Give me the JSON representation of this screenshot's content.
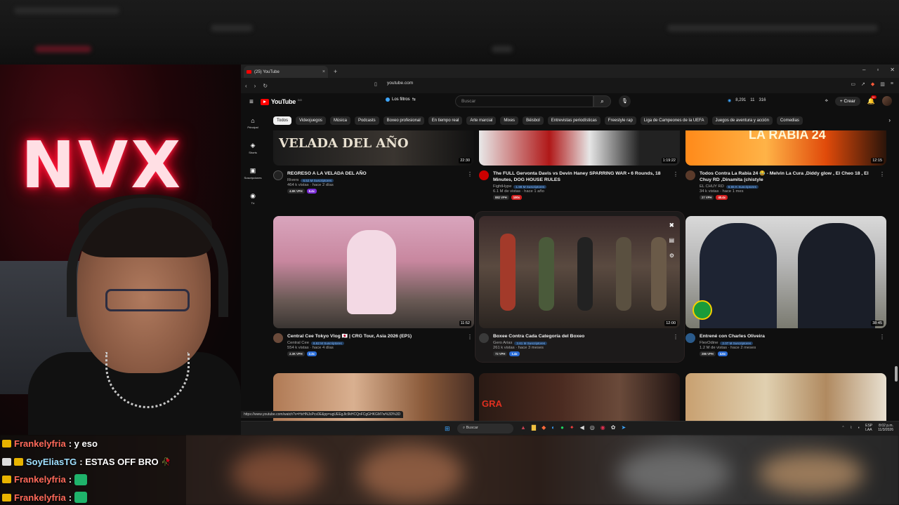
{
  "stream": {
    "neon_sign": "NVX"
  },
  "browser": {
    "tab_title": "(25) YouTube",
    "tab_close": "×",
    "tab_new": "+",
    "url": "youtube.com",
    "status_url": "https://www.youtube.com/watch?v=HxHNJsPcs0E&pp=ugUEEgJlc9kHCQnFCgGHKGM7w%3D%3D"
  },
  "youtube": {
    "logo_text": "YouTube",
    "logo_country": "DO",
    "filters_label": "Los filtros",
    "search_placeholder": "Buscar",
    "stats": {
      "a": "8,291",
      "b": "11",
      "c": "316"
    },
    "create_label": "Crear",
    "notif_badge": "9+",
    "sidebar": [
      {
        "icon": "⌂",
        "label": "Principal"
      },
      {
        "icon": "◈",
        "label": "Shorts"
      },
      {
        "icon": "▣",
        "label": "Suscripciones"
      },
      {
        "icon": "◉",
        "label": "Tú"
      }
    ],
    "chips": [
      "Todos",
      "Videojuegos",
      "Música",
      "Podcasts",
      "Boxeo profesional",
      "En tiempo real",
      "Arte marcial",
      "Mixes",
      "Béisbol",
      "Entrevistas periodísticas",
      "Freestyle rap",
      "Liga de Campeones de la UEFA",
      "Juegos de aventura y acción",
      "Comedias"
    ],
    "row1": [
      {
        "title": "REGRESO A LA VELADA DEL AÑO",
        "channel": "Rivers",
        "subs": "6.52 M Suscriptores",
        "views": "464 k vistas · hace 2 días",
        "vph": "4.8K VPH",
        "mult": "6.4x",
        "duration": "22:30",
        "thumb_text": "VELADA DEL AÑO"
      },
      {
        "title": "The FULL Gervonta Davis vs Devin Haney SPARRING WAR • 6 Rounds, 18 Minutes, DOG HOUSE RULES",
        "channel": "FightHype",
        "subs": "1.98 M Suscriptores",
        "views": "6.1 M de vistas · hace 1 año",
        "vph": "882 VPH",
        "mult": "100x",
        "duration": "1:19:22",
        "thumb_text": ""
      },
      {
        "title": "Todos Contra La Rabia 24 😂 - Melvin La Cura ,Diddy glow , El Cheo 18 , El Chuy RD ,Dinamita (chistyle",
        "channel": "EL CHUY RD",
        "subs": "6.65 K Suscriptores",
        "views": "34 k vistas · hace 1 mes",
        "vph": "27 VPH",
        "mult": "40.4x",
        "duration": "12:15",
        "thumb_text": "LA RABIA 24"
      }
    ],
    "row2": [
      {
        "title": "Central Cee Tokyo Vlog 🇯🇵 | CRG Tour, Asia 2026 (EP1)",
        "channel": "Central Cee",
        "subs": "6.62 M Suscriptores",
        "views": "554 k vistas · hace 4 días",
        "vph": "2.3K VPH",
        "mult": "2.3x",
        "duration": "11:52"
      },
      {
        "title": "Boxee Contra Cada Categoría del Boxeo",
        "channel": "Gero Arias",
        "subs": "3.61 M Suscriptores",
        "views": "261 k vistas · hace 3 meses",
        "vph": "72 VPH",
        "mult": "1.4x",
        "duration": "12:00"
      },
      {
        "title": "Entrené con Charles Oliveira",
        "channel": "FlexOdine",
        "subs": "2.07 M Suscriptores",
        "views": "1.2 M de vistas · hace 2 meses",
        "vph": "286 VPH",
        "mult": "4.6x",
        "duration": "38:45"
      }
    ],
    "row3_thumb_text": "GRA"
  },
  "taskbar": {
    "search": "Buscar",
    "lang": "ESP\nLAA",
    "time": "8:02 p.m.",
    "date": "11/3/2026"
  },
  "chat": [
    {
      "user": "Frankelyfria",
      "msg": ": y eso",
      "color": "a"
    },
    {
      "user": "SoyEliasTG",
      "msg": ": ESTAS OFF BRO",
      "color": "b"
    },
    {
      "user": "Frankelyfria",
      "msg": ":",
      "color": "a"
    },
    {
      "user": "Frankelyfria",
      "msg": ":",
      "color": "a"
    }
  ]
}
